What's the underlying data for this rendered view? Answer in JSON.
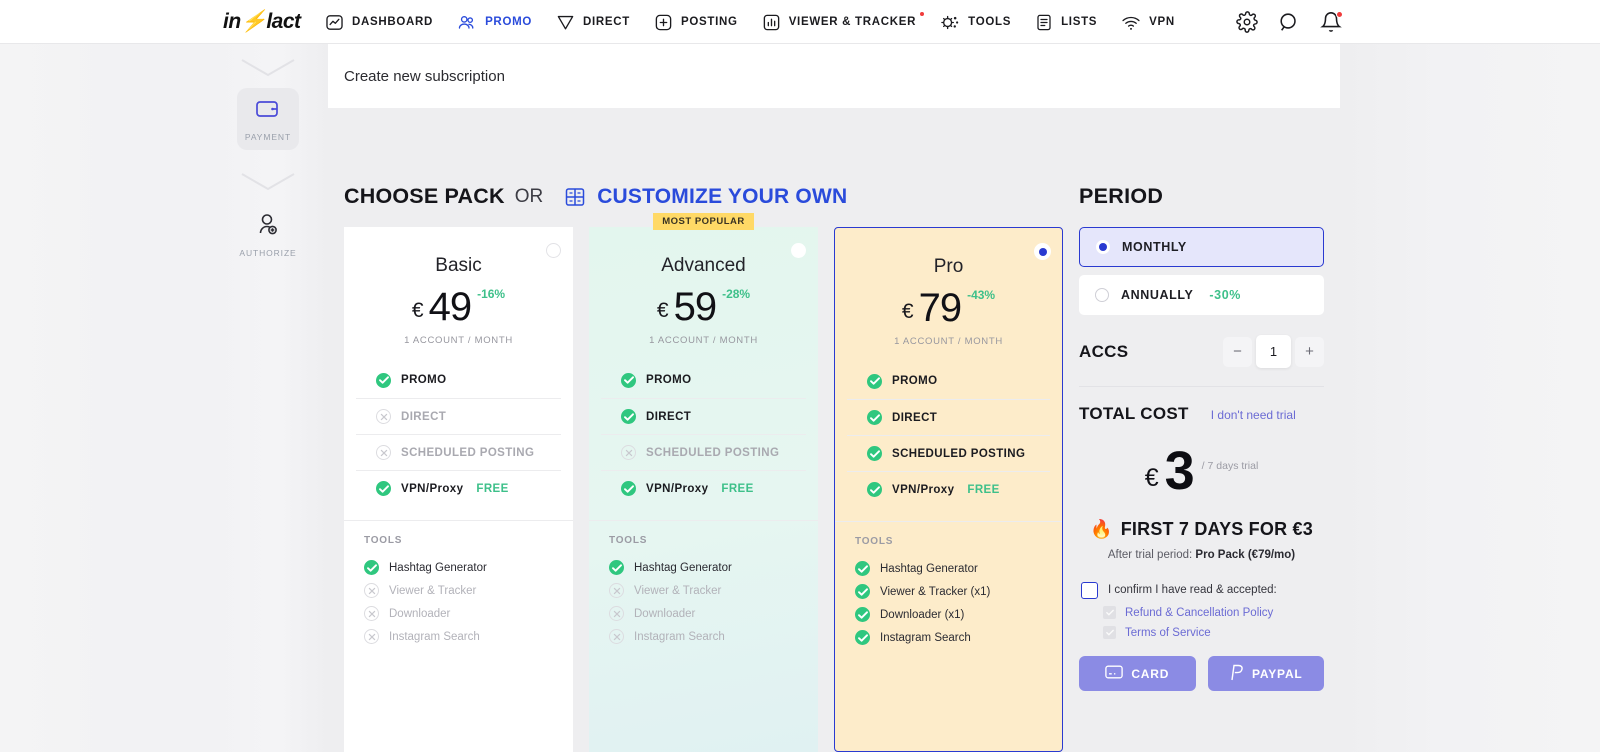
{
  "brand": {
    "name_prefix": "in",
    "name_suffix": "lact"
  },
  "nav": {
    "items": [
      {
        "label": "DASHBOARD",
        "icon": "dashboard-icon",
        "active": false,
        "dot": false
      },
      {
        "label": "PROMO",
        "icon": "promo-icon",
        "active": true,
        "dot": false
      },
      {
        "label": "DIRECT",
        "icon": "direct-icon",
        "active": false,
        "dot": false
      },
      {
        "label": "POSTING",
        "icon": "posting-icon",
        "active": false,
        "dot": false
      },
      {
        "label": "VIEWER & TRACKER",
        "icon": "viewer-tracker-icon",
        "active": false,
        "dot": true
      },
      {
        "label": "TOOLS",
        "icon": "tools-icon",
        "active": false,
        "dot": false
      },
      {
        "label": "LISTS",
        "icon": "lists-icon",
        "active": false,
        "dot": false
      },
      {
        "label": "VPN",
        "icon": "vpn-icon",
        "active": false,
        "dot": false
      }
    ],
    "right_icons": [
      "gear-icon",
      "search-icon",
      "bell-icon"
    ]
  },
  "rail": {
    "steps": [
      {
        "label": "PAYMENT",
        "icon": "wallet-icon",
        "current": true
      },
      {
        "label": "AUTHORIZE",
        "icon": "user-add-icon",
        "current": false
      }
    ]
  },
  "breadcrumb": "Create new subscription",
  "headings": {
    "choose_pack": "CHOOSE PACK",
    "or": "OR",
    "customize": "CUSTOMIZE YOUR OWN",
    "period": "PERIOD"
  },
  "badge": {
    "most_popular": "MOST POPULAR"
  },
  "plans": [
    {
      "name": "Basic",
      "currency": "€",
      "price": "49",
      "discount": "-16%",
      "per": "1 ACCOUNT / MONTH",
      "selected": false,
      "popular": false,
      "features": [
        {
          "label": "PROMO",
          "on": true
        },
        {
          "label": "DIRECT",
          "on": false
        },
        {
          "label": "SCHEDULED POSTING",
          "on": false
        },
        {
          "label": "VPN/Proxy",
          "on": true,
          "tag": "FREE"
        }
      ],
      "tools_header": "TOOLS",
      "tools": [
        {
          "label": "Hashtag Generator",
          "on": true
        },
        {
          "label": "Viewer & Tracker",
          "on": false
        },
        {
          "label": "Downloader",
          "on": false
        },
        {
          "label": "Instagram Search",
          "on": false
        }
      ]
    },
    {
      "name": "Advanced",
      "currency": "€",
      "price": "59",
      "discount": "-28%",
      "per": "1 ACCOUNT / MONTH",
      "selected": false,
      "popular": true,
      "features": [
        {
          "label": "PROMO",
          "on": true
        },
        {
          "label": "DIRECT",
          "on": true
        },
        {
          "label": "SCHEDULED POSTING",
          "on": false
        },
        {
          "label": "VPN/Proxy",
          "on": true,
          "tag": "FREE"
        }
      ],
      "tools_header": "TOOLS",
      "tools": [
        {
          "label": "Hashtag Generator",
          "on": true
        },
        {
          "label": "Viewer & Tracker",
          "on": false
        },
        {
          "label": "Downloader",
          "on": false
        },
        {
          "label": "Instagram Search",
          "on": false
        }
      ]
    },
    {
      "name": "Pro",
      "currency": "€",
      "price": "79",
      "discount": "-43%",
      "per": "1 ACCOUNT / MONTH",
      "selected": true,
      "popular": false,
      "features": [
        {
          "label": "PROMO",
          "on": true
        },
        {
          "label": "DIRECT",
          "on": true
        },
        {
          "label": "SCHEDULED POSTING",
          "on": true
        },
        {
          "label": "VPN/Proxy",
          "on": true,
          "tag": "FREE"
        }
      ],
      "tools_header": "TOOLS",
      "tools": [
        {
          "label": "Hashtag Generator",
          "on": true
        },
        {
          "label": "Viewer & Tracker (x1)",
          "on": true
        },
        {
          "label": "Downloader (x1)",
          "on": true
        },
        {
          "label": "Instagram Search",
          "on": true
        }
      ]
    }
  ],
  "period": {
    "options": [
      {
        "label": "MONTHLY",
        "discount": "",
        "selected": true
      },
      {
        "label": "ANNUALLY",
        "discount": "-30%",
        "selected": false
      }
    ]
  },
  "accs": {
    "label": "ACCS",
    "value": "1",
    "minus": "−",
    "plus": "+"
  },
  "total": {
    "label": "TOTAL COST",
    "no_trial_link": "I don't need trial",
    "currency": "€",
    "amount": "3",
    "note": "/ 7 days trial",
    "promo_title": "FIRST 7 DAYS FOR €3",
    "promo_emoji": "🔥",
    "after_trial_prefix": "After trial period: ",
    "after_trial_value": "Pro Pack (€79/mo)"
  },
  "consent": {
    "confirm_text": "I confirm I have read & accepted:",
    "links": [
      "Refund & Cancellation Policy",
      "Terms of Service"
    ]
  },
  "pay": {
    "buttons": [
      {
        "label": "CARD",
        "icon": "credit-card-icon"
      },
      {
        "label": "PAYPAL",
        "icon": "paypal-icon"
      }
    ]
  },
  "colors": {
    "accent_blue": "#2a3ad0",
    "link_blue": "#6b6bd4",
    "green": "#2fc77f",
    "badge_yellow": "#ffd966",
    "pro_bg": "#fdecca",
    "advanced_bg": "#e3f6ee",
    "pay_button": "#8b8be4"
  }
}
